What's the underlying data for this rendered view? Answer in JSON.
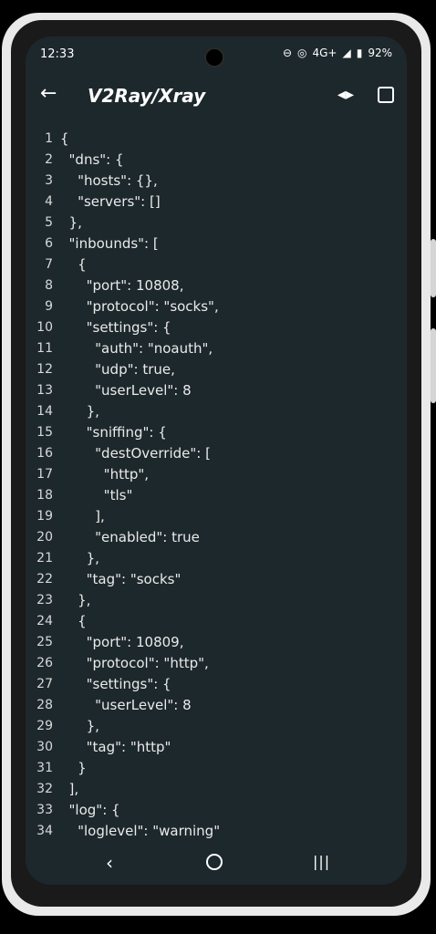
{
  "status": {
    "time": "12:33",
    "network": "4G+",
    "battery": "92%"
  },
  "appbar": {
    "title": "V2Ray/Xray",
    "back_icon": "back-arrow-icon",
    "action1_icon": "code-icon",
    "action2_icon": "save-icon"
  },
  "editor": {
    "lines": [
      {
        "n": "1",
        "t": "{"
      },
      {
        "n": "2",
        "t": "  \"dns\": {"
      },
      {
        "n": "3",
        "t": "    \"hosts\": {},"
      },
      {
        "n": "4",
        "t": "    \"servers\": []"
      },
      {
        "n": "5",
        "t": "  },"
      },
      {
        "n": "6",
        "t": "  \"inbounds\": ["
      },
      {
        "n": "7",
        "t": "    {"
      },
      {
        "n": "8",
        "t": "      \"port\": 10808,"
      },
      {
        "n": "9",
        "t": "      \"protocol\": \"socks\","
      },
      {
        "n": "10",
        "t": "      \"settings\": {"
      },
      {
        "n": "11",
        "t": "        \"auth\": \"noauth\","
      },
      {
        "n": "12",
        "t": "        \"udp\": true,"
      },
      {
        "n": "13",
        "t": "        \"userLevel\": 8"
      },
      {
        "n": "14",
        "t": "      },"
      },
      {
        "n": "15",
        "t": "      \"sniffing\": {"
      },
      {
        "n": "16",
        "t": "        \"destOverride\": ["
      },
      {
        "n": "17",
        "t": "          \"http\","
      },
      {
        "n": "18",
        "t": "          \"tls\""
      },
      {
        "n": "19",
        "t": "        ],"
      },
      {
        "n": "20",
        "t": "        \"enabled\": true"
      },
      {
        "n": "21",
        "t": "      },"
      },
      {
        "n": "22",
        "t": "      \"tag\": \"socks\""
      },
      {
        "n": "23",
        "t": "    },"
      },
      {
        "n": "24",
        "t": "    {"
      },
      {
        "n": "25",
        "t": "      \"port\": 10809,"
      },
      {
        "n": "26",
        "t": "      \"protocol\": \"http\","
      },
      {
        "n": "27",
        "t": "      \"settings\": {"
      },
      {
        "n": "28",
        "t": "        \"userLevel\": 8"
      },
      {
        "n": "29",
        "t": "      },"
      },
      {
        "n": "30",
        "t": "      \"tag\": \"http\""
      },
      {
        "n": "31",
        "t": "    }"
      },
      {
        "n": "32",
        "t": "  ],"
      },
      {
        "n": "33",
        "t": "  \"log\": {"
      },
      {
        "n": "34",
        "t": "    \"loglevel\": \"warning\""
      }
    ]
  },
  "nav": {
    "back_icon": "nav-back-icon",
    "home_icon": "nav-home-icon",
    "recents_icon": "nav-recents-icon"
  }
}
